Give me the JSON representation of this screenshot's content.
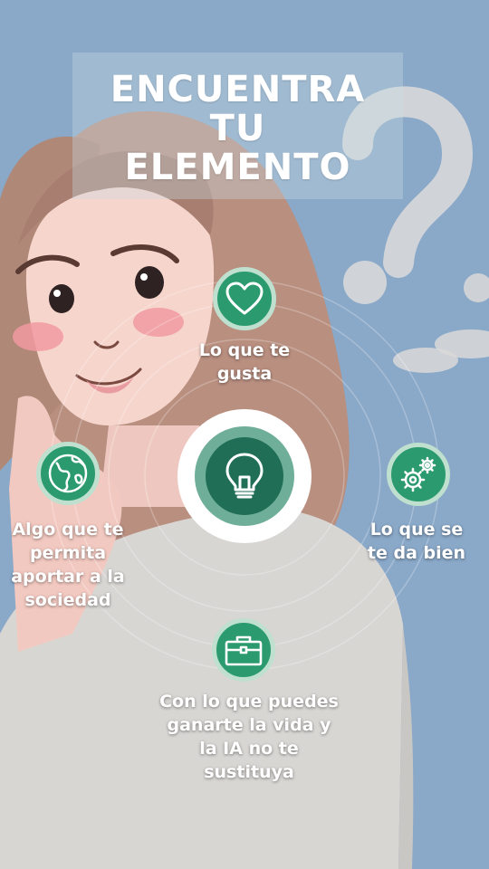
{
  "title": {
    "line1": "ENCUENTRA",
    "line2": "TU",
    "line3": "ELEMENTO"
  },
  "center": {
    "icon": "lightbulb-icon"
  },
  "items": [
    {
      "icon": "heart-icon",
      "label_lines": [
        "Lo que te",
        "gusta"
      ]
    },
    {
      "icon": "gears-icon",
      "label_lines": [
        "Lo que se",
        "te da bien"
      ]
    },
    {
      "icon": "briefcase-icon",
      "label_lines": [
        "Con lo que puedes",
        "ganarte la vida y",
        "la IA no te",
        "sustituya"
      ]
    },
    {
      "icon": "globe-icon",
      "label_lines": [
        "Algo que te",
        "permita",
        "aportar a la",
        "sociedad"
      ]
    }
  ],
  "colors": {
    "background": "#8aa8c8",
    "badge": "#2b9a6e",
    "hub_inner": "#1f6e55",
    "text": "#ffffff"
  }
}
